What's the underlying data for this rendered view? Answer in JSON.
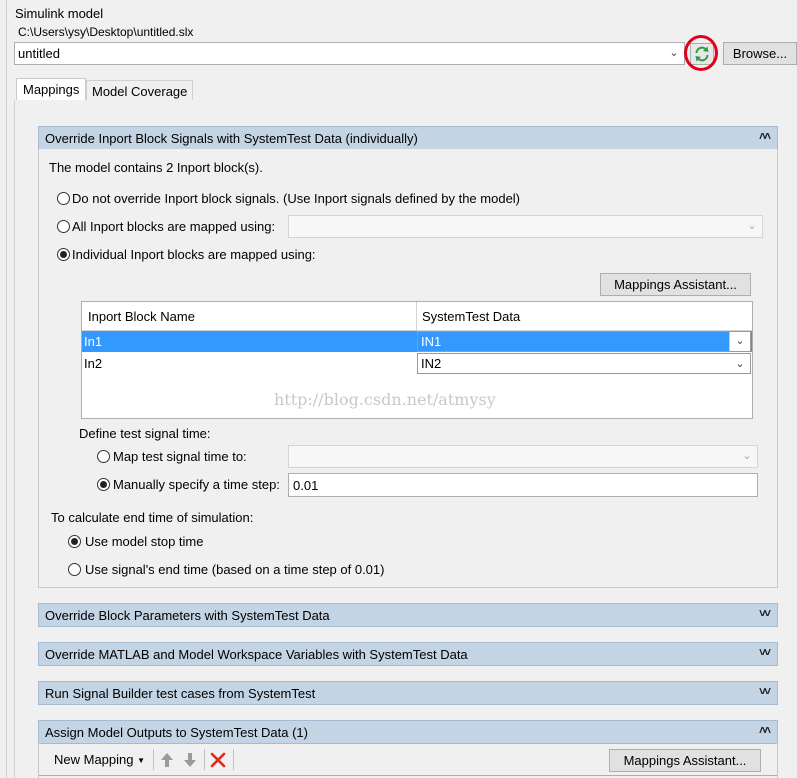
{
  "model": {
    "heading": "Simulink model",
    "path": "C:\\Users\\ysy\\Desktop\\untitled.slx",
    "selected": "untitled",
    "browse_label": "Browse..."
  },
  "tabs": [
    {
      "label": "Mappings",
      "active": true
    },
    {
      "label": "Model Coverage",
      "active": false
    }
  ],
  "override_inport": {
    "title": "Override Inport Block Signals with SystemTest Data (individually)",
    "count_text": "The model contains 2 Inport block(s).",
    "options": [
      {
        "label": "Do not override Inport block signals. (Use Inport signals defined by the model)",
        "checked": false
      },
      {
        "label": "All Inport blocks are mapped using:",
        "checked": false
      },
      {
        "label": "Individual Inport blocks are mapped using:",
        "checked": true
      }
    ],
    "mappings_assistant_label": "Mappings Assistant...",
    "table": {
      "headers": [
        "Inport Block Name",
        "SystemTest Data"
      ],
      "rows": [
        {
          "name": "In1",
          "data": "IN1",
          "selected": true
        },
        {
          "name": "In2",
          "data": "IN2",
          "selected": false
        }
      ]
    },
    "watermark": "http://blog.csdn.net/atmysy",
    "signal_time": {
      "heading": "Define test signal time:",
      "map_label": "Map test signal time to:",
      "manual_label": "Manually specify a time step:",
      "manual_checked": true,
      "time_step": "0.01"
    },
    "end_time": {
      "heading": "To calculate end time of simulation:",
      "model_stop_label": "Use model stop time",
      "signal_end_label": "Use signal's end time (based on a time step of 0.01)",
      "model_stop_checked": true
    }
  },
  "sections": [
    {
      "title": "Override Block Parameters with SystemTest Data"
    },
    {
      "title": "Override MATLAB and Model Workspace Variables with SystemTest Data"
    },
    {
      "title": "Run Signal Builder test cases from SystemTest"
    }
  ],
  "outputs": {
    "title": "Assign Model Outputs to SystemTest Data (1)",
    "new_mapping_label": "New Mapping",
    "mappings_assistant_label": "Mappings Assistant..."
  },
  "colors": {
    "section_header": "#c3d4e5",
    "selection": "#3399ff",
    "highlight_circle": "#e0001b",
    "refresh_icon": "#2e9e3e"
  },
  "icons": [
    "refresh-icon",
    "chevron-down-icon",
    "double-chevron-up-icon",
    "double-chevron-down-icon",
    "arrow-up-icon",
    "arrow-down-icon",
    "delete-x-icon"
  ]
}
